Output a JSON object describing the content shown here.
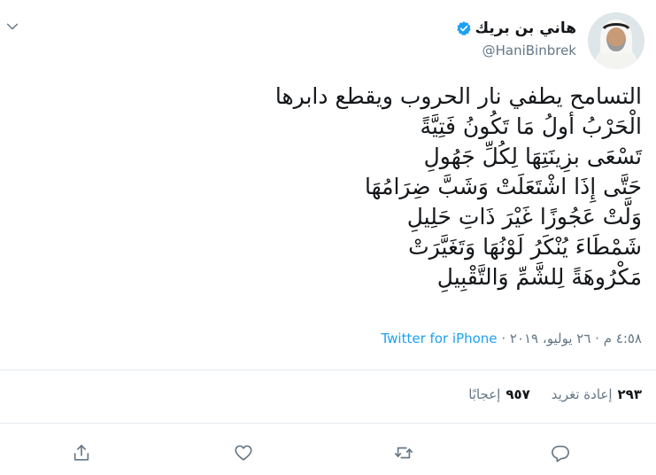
{
  "author": {
    "display_name": "هاني بن بريك",
    "handle": "@HaniBinbrek",
    "verified": true
  },
  "tweet": {
    "lines": [
      "التسامح يطفي نار الحروب ويقطع دابرها",
      "الْحَرْبُ أولُ مَا تَكُونُ فَتِيَّةً",
      "تَسْعَى بزِينَتِهَا لِكُلِّ جَهُولِ",
      "حَتَّى إِذَا اشْتَعَلَتْ وَشَبَّ ضِرَامُهَا",
      "وَلَّتْ عَجُوزًا غَيْرَ ذَاتِ حَلِيلِ",
      "شَمْطَاءَ يُنْكَرُ لَوْنُهَا وَتَغَيَّرَتْ",
      "مَكْرُوهَةً لِلشَّمِّ وَالتَّقْبِيلِ"
    ]
  },
  "meta": {
    "timestamp": "٤:٥٨ م · ٢٦ يوليو، ٢٠١٩",
    "separator": "·",
    "source": "Twitter for iPhone"
  },
  "stats": {
    "retweets_count": "٢٩٣",
    "retweets_label": "إعادة تغريد",
    "likes_count": "٩٥٧",
    "likes_label": "إعجابًا"
  },
  "icons": {
    "menu": "chevron-down-icon",
    "verified": "verified-badge-icon",
    "reply": "reply-icon",
    "retweet": "retweet-icon",
    "like": "heart-icon",
    "share": "share-icon"
  },
  "colors": {
    "accent": "#1da1f2",
    "text": "#14171a",
    "muted": "#657786",
    "divider": "#e6ecf0"
  }
}
